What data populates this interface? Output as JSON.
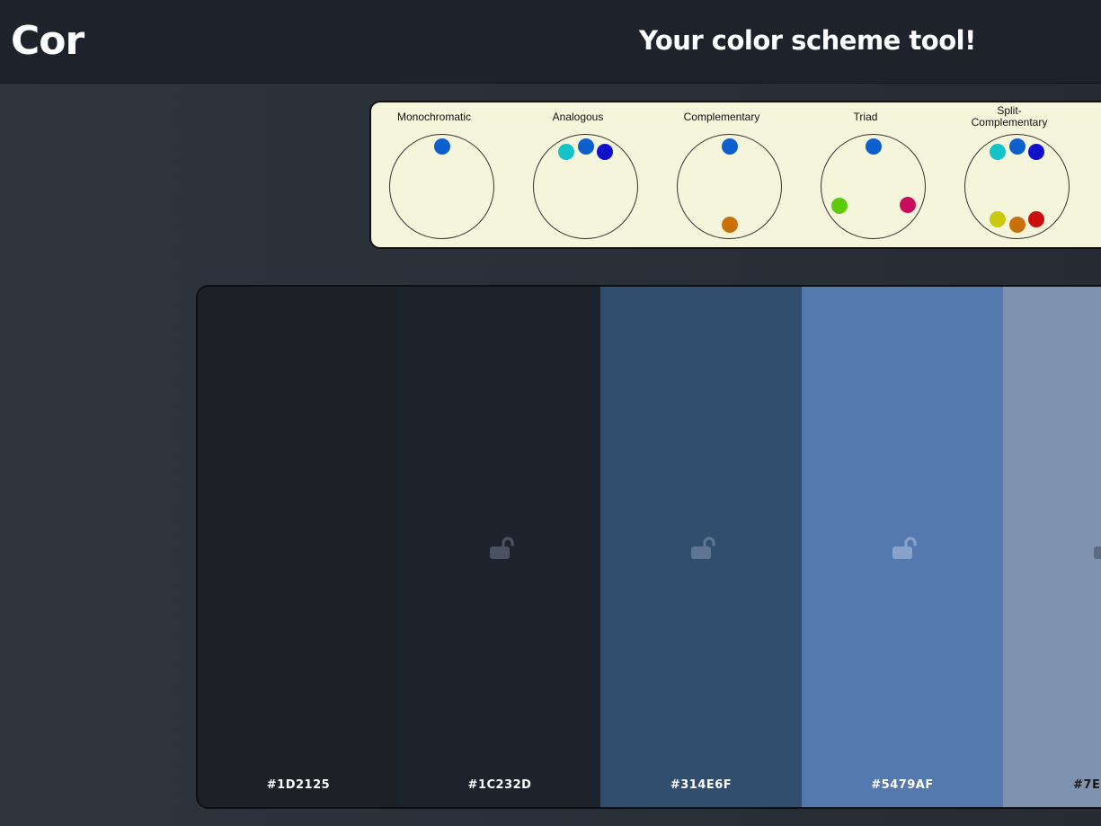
{
  "app": {
    "logo": "Cor",
    "tagline": "Your color scheme tool!"
  },
  "schemes": [
    {
      "label": "Monochromatic",
      "dots": [
        {
          "color": "#0d5fcc"
        }
      ]
    },
    {
      "label": "Analogous",
      "dots": [
        {
          "color": "#12c3c8"
        },
        {
          "color": "#0d5fcc"
        },
        {
          "color": "#120fc9"
        }
      ]
    },
    {
      "label": "Complementary",
      "dots": [
        {
          "color": "#0d5fcc"
        },
        {
          "color": "#c9700d"
        }
      ]
    },
    {
      "label": "Triad",
      "dots": [
        {
          "color": "#0d5fcc"
        },
        {
          "color": "#5ec90d"
        },
        {
          "color": "#c90d5e"
        }
      ]
    },
    {
      "label": "Split-\nComplementary",
      "dots": [
        {
          "color": "#12c3c8"
        },
        {
          "color": "#0d5fcc"
        },
        {
          "color": "#120fc9"
        },
        {
          "color": "#c9c90d"
        },
        {
          "color": "#c9700d"
        },
        {
          "color": "#c9100d"
        }
      ]
    }
  ],
  "palette": [
    {
      "hex": "#1D2125",
      "color": "#1d2125",
      "locked": null,
      "lock_color": null
    },
    {
      "hex": "#1C232D",
      "color": "#1c232d",
      "locked": false,
      "lock_color": "#4a5160"
    },
    {
      "hex": "#314E6F",
      "color": "#314e6f",
      "locked": false,
      "lock_color": "#5f7592"
    },
    {
      "hex": "#5479AF",
      "color": "#5479af",
      "locked": false,
      "lock_color": "#88a2cb"
    },
    {
      "hex": "#7E",
      "color": "#7e93b0",
      "locked": false,
      "lock_color": "#5c6b80"
    }
  ]
}
